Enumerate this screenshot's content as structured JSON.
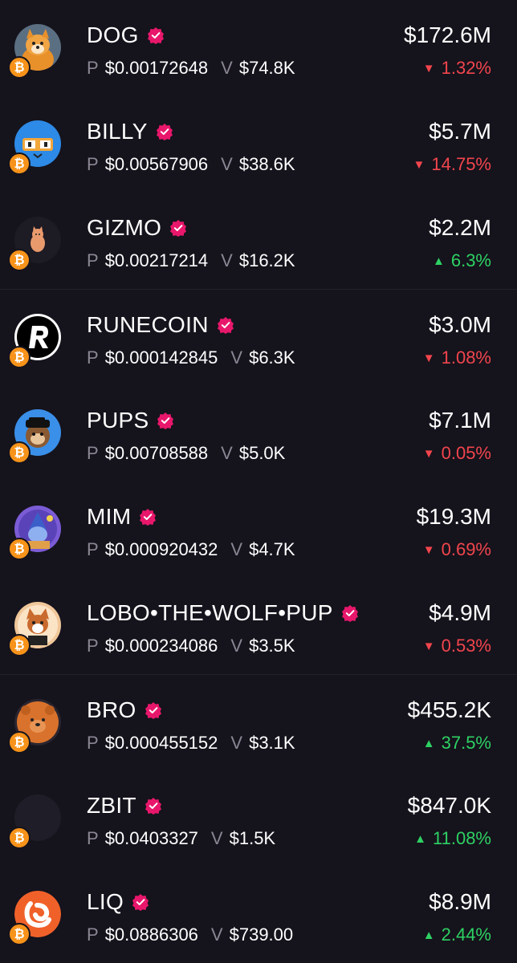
{
  "labels": {
    "price_prefix": "P",
    "volume_prefix": "V",
    "chain_symbol": "₿"
  },
  "colors": {
    "background": "#15131c",
    "verified": "#e8176b",
    "up": "#2ed163",
    "down": "#f2454d",
    "bitcoin": "#f7931a",
    "muted": "#8a8794"
  },
  "tokens": [
    {
      "name": "DOG",
      "price": "$0.00172648",
      "volume": "$74.8K",
      "market_cap": "$172.6M",
      "change": "1.32%",
      "direction": "down",
      "icon": "shiba-dog-avatar"
    },
    {
      "name": "BILLY",
      "price": "$0.00567906",
      "volume": "$38.6K",
      "market_cap": "$5.7M",
      "change": "14.75%",
      "direction": "down",
      "icon": "billy-cat-avatar"
    },
    {
      "name": "GIZMO",
      "price": "$0.00217214",
      "volume": "$16.2K",
      "market_cap": "$2.2M",
      "change": "6.3%",
      "direction": "up",
      "icon": "gizmo-cat-avatar"
    },
    {
      "name": "RUNECOIN",
      "price": "$0.000142845",
      "volume": "$6.3K",
      "market_cap": "$3.0M",
      "change": "1.08%",
      "direction": "down",
      "icon": "runecoin-r-avatar"
    },
    {
      "name": "PUPS",
      "price": "$0.00708588",
      "volume": "$5.0K",
      "market_cap": "$7.1M",
      "change": "0.05%",
      "direction": "down",
      "icon": "pups-monkey-avatar"
    },
    {
      "name": "MIM",
      "price": "$0.000920432",
      "volume": "$4.7K",
      "market_cap": "$19.3M",
      "change": "0.69%",
      "direction": "down",
      "icon": "mim-wizard-avatar"
    },
    {
      "name": "LOBO•THE•WOLF•PUP",
      "price": "$0.000234086",
      "volume": "$3.5K",
      "market_cap": "$4.9M",
      "change": "0.53%",
      "direction": "down",
      "icon": "lobo-wolf-avatar"
    },
    {
      "name": "BRO",
      "price": "$0.000455152",
      "volume": "$3.1K",
      "market_cap": "$455.2K",
      "change": "37.5%",
      "direction": "up",
      "icon": "bro-bear-avatar"
    },
    {
      "name": "ZBIT",
      "price": "$0.0403327",
      "volume": "$1.5K",
      "market_cap": "$847.0K",
      "change": "11.08%",
      "direction": "up",
      "icon": "zbit-blank-avatar"
    },
    {
      "name": "LIQ",
      "price": "$0.0886306",
      "volume": "$739.00",
      "market_cap": "$8.9M",
      "change": "2.44%",
      "direction": "up",
      "icon": "liq-logo-avatar"
    }
  ]
}
